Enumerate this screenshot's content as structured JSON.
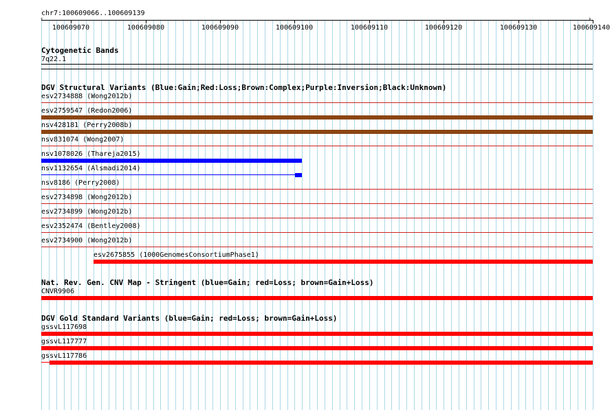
{
  "colors": {
    "gain": "#0000ff",
    "loss": "#ff0000",
    "complex": "#8b4513",
    "grid": "#add8e6",
    "separator": "#cc2222"
  },
  "ruler": {
    "location": "chr7:100609066..100609139",
    "ticks": [
      "100609070",
      "100609080",
      "100609090",
      "100609100",
      "100609110",
      "100609120",
      "100609130",
      "100609140"
    ]
  },
  "cytoband": {
    "title": "Cytogenetic Bands",
    "band": "7q22.1"
  },
  "dgv": {
    "title": "DGV Structural Variants (Blue:Gain;Red:Loss;Brown:Complex;Purple:Inversion;Black:Unknown)",
    "tracks": [
      {
        "label": "esv2734888 (Wong2012b)"
      },
      {
        "label": "esv2759547 (Redon2006)"
      },
      {
        "label": "nsv428181 (Perry2008b)"
      },
      {
        "label": "nsv831074 (Wong2007)"
      },
      {
        "label": "nsv1078026 (Thareja2015)"
      },
      {
        "label": "nsv1132654 (Alsmadi2014)"
      },
      {
        "label": "nsv8186 (Perry2008)"
      },
      {
        "label": "esv2734898 (Wong2012b)"
      },
      {
        "label": "esv2734899 (Wong2012b)"
      },
      {
        "label": "esv2352474 (Bentley2008)"
      },
      {
        "label": "esv2734900 (Wong2012b)"
      },
      {
        "label": "esv2675855 (1000GenomesConsortiumPhase1)"
      }
    ]
  },
  "cnvmap": {
    "title": "Nat. Rev. Gen. CNV Map - Stringent (blue=Gain; red=Loss; brown=Gain+Loss)",
    "label": "CNVR9906"
  },
  "gold": {
    "title": "DGV Gold Standard Variants (blue=Gain; red=Loss; brown=Gain+Loss)",
    "labels": [
      "gssvL117698",
      "gssvL117777",
      "gssvL117786"
    ]
  }
}
